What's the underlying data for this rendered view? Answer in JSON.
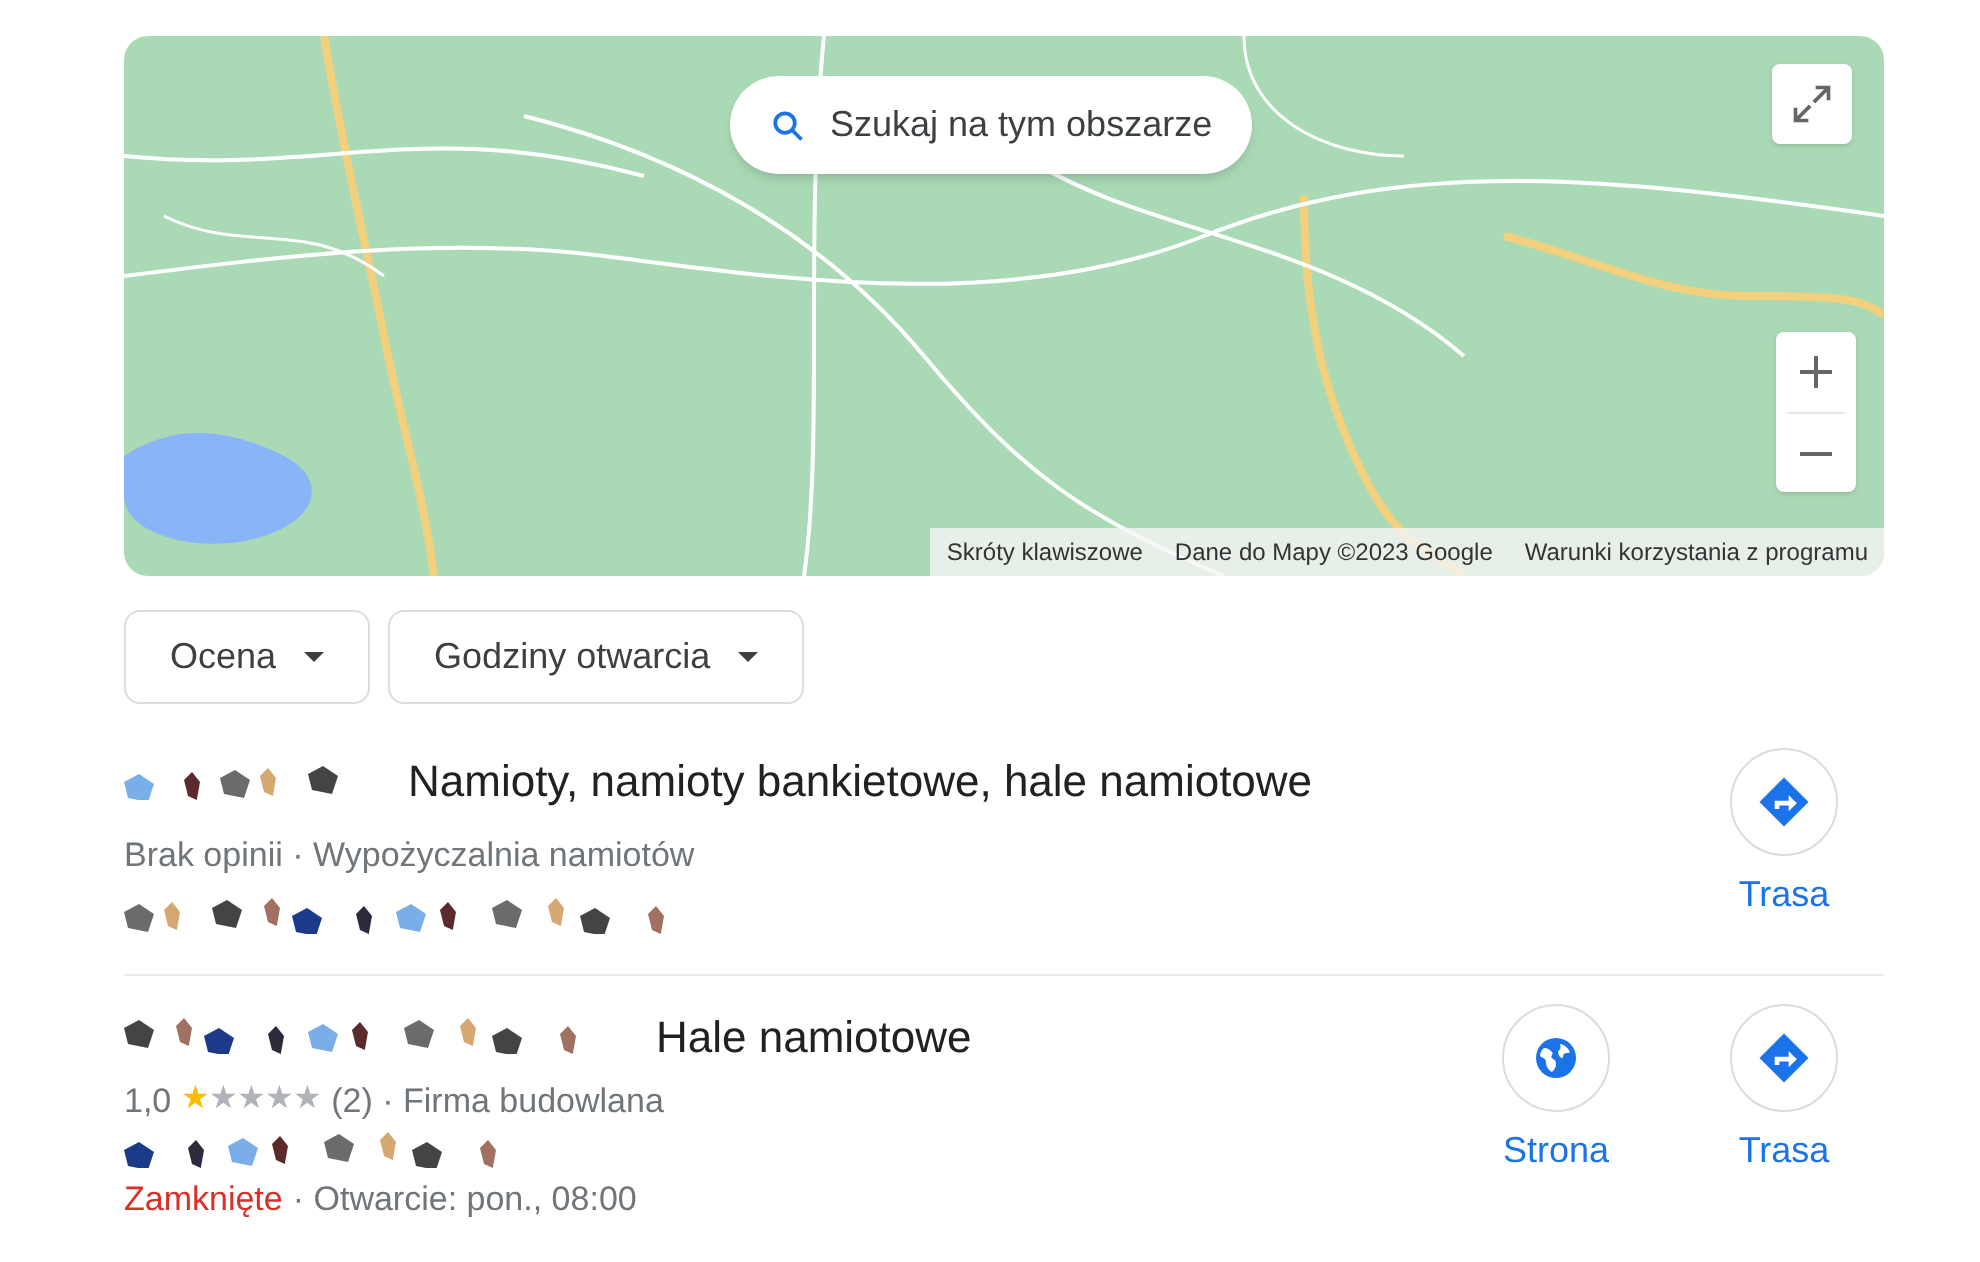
{
  "map": {
    "search_button": "Szukaj na tym obszarze",
    "attribution": [
      "Skróty klawiszowe",
      "Dane do Mapy ©2023 Google",
      "Warunki korzystania z programu"
    ]
  },
  "filters": [
    {
      "label": "Ocena"
    },
    {
      "label": "Godziny otwarcia"
    }
  ],
  "results": [
    {
      "name": "Namioty, namioty bankietowe, hale namiotowe",
      "details": "Brak opinii · Wypożyczalnia namiotów",
      "actions": [
        {
          "kind": "directions",
          "label": "Trasa"
        }
      ]
    },
    {
      "name": "Hale namiotowe",
      "rating": "1,0",
      "stars": 1,
      "review_details": "(2) · Firma budowlana",
      "status": {
        "text": "Zamknięte",
        "open": false
      },
      "hours": "· Otwarcie: pon., 08:00",
      "actions": [
        {
          "kind": "website",
          "label": "Strona"
        },
        {
          "kind": "directions",
          "label": "Trasa"
        }
      ]
    }
  ]
}
